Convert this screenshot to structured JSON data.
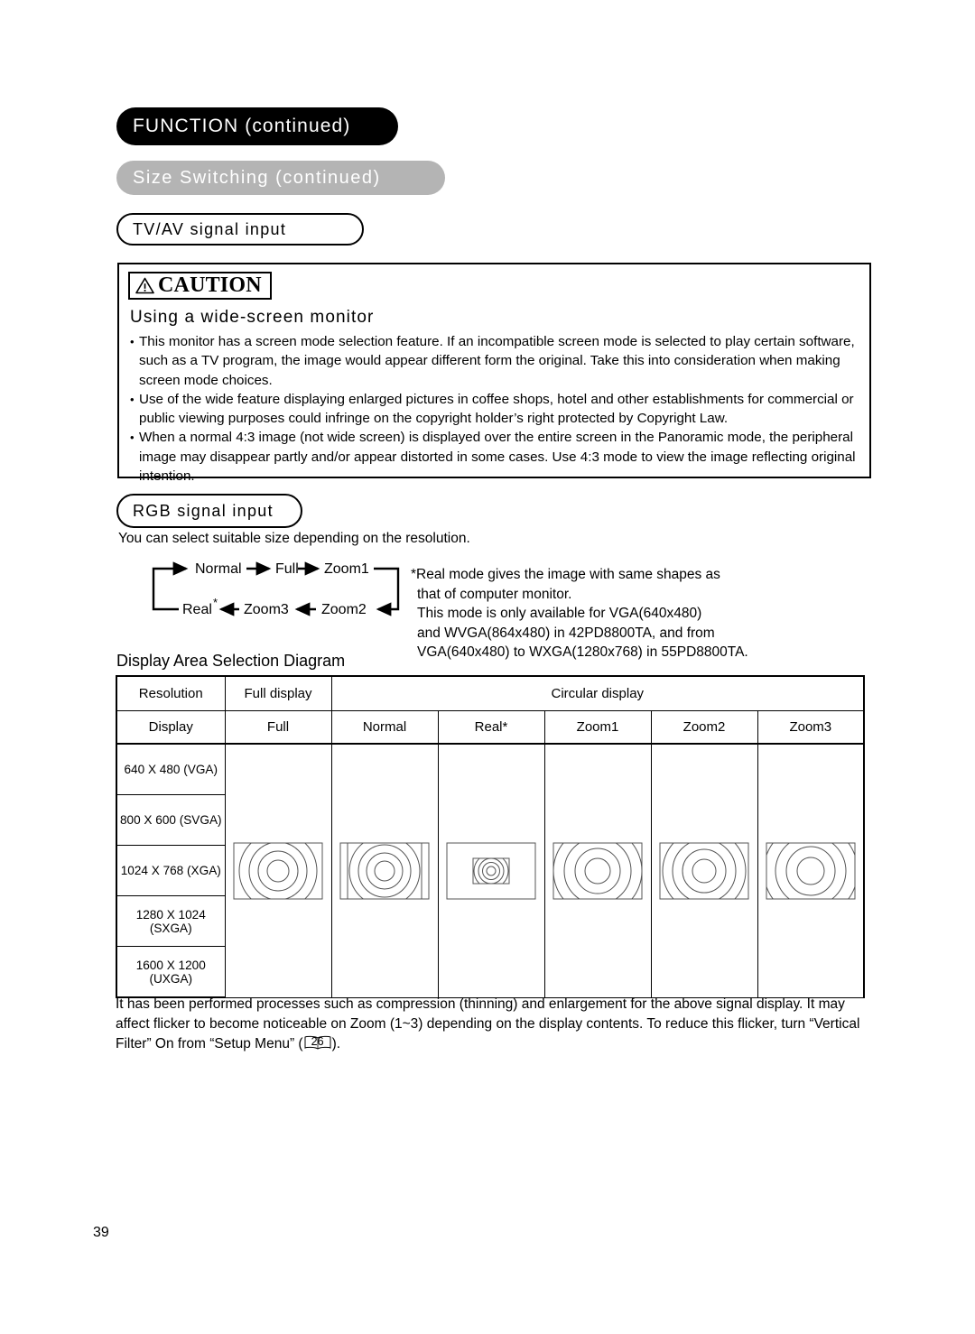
{
  "header": {
    "chapter": "FUNCTION (continued)",
    "section": "Size Switching (continued)",
    "subsection_tvav": "TV/AV signal input",
    "subsection_rgb": "RGB signal input"
  },
  "caution": {
    "badge_label": "CAUTION",
    "badge_icon": "warning-triangle-icon",
    "subtitle": "Using a wide-screen monitor",
    "bullets": [
      "This monitor has a screen mode selection feature. If an incompatible screen mode is selected to play certain software, such as a TV program, the image would appear different form the original. Take this into consideration when making screen mode choices.",
      "Use of the wide feature displaying enlarged pictures in coffee shops, hotel and other establishments for commercial or public viewing purposes could infringe on the copyright holder’s right protected by Copyright Law.",
      "When a normal 4:3 image (not wide screen) is displayed over the entire screen in the Panoramic mode, the peripheral image may disappear partly and/or appear distorted in some cases. Use 4:3 mode to view the image reflecting original intention."
    ]
  },
  "rgb": {
    "lead": "You can select suitable size depending on the resolution.",
    "cycle": {
      "top_row": [
        "Normal",
        "Full",
        "Zoom1"
      ],
      "bottom_row": [
        "Real*",
        "Zoom3",
        "Zoom2"
      ],
      "labels": {
        "normal": "Normal",
        "full": "Full",
        "zoom1": "Zoom1",
        "zoom2": "Zoom2",
        "zoom3": "Zoom3",
        "real": "Real",
        "real_star": "*"
      }
    },
    "note_lines": [
      "*Real mode gives the image with same shapes as",
      "that of computer monitor.",
      "This mode is only available for VGA(640x480)",
      "and WVGA(864x480) in 42PD8800TA, and from",
      "VGA(640x480) to WXGA(1280x768) in 55PD8800TA."
    ]
  },
  "table": {
    "title": "Display Area Selection Diagram",
    "group_headers": {
      "resolution": "Resolution",
      "full_display": "Full display",
      "circular_display": "Circular display"
    },
    "column_headers": [
      "Display",
      "Full",
      "Normal",
      "Real*",
      "Zoom1",
      "Zoom2",
      "Zoom3"
    ],
    "resolutions": [
      "640 X 480 (VGA)",
      "800 X 600 (SVGA)",
      "1024 X 768 (XGA)",
      "1280 X 1024 (SXGA)",
      "1600 X 1200 (UXGA)"
    ],
    "diagram_names": [
      "full-diagram",
      "normal-diagram",
      "real-diagram",
      "zoom1-diagram",
      "zoom2-diagram",
      "zoom3-diagram"
    ]
  },
  "footer": {
    "paragraph_part1": "It has been performed processes such as compression (thinning) and enlargement for the above signal display. It may affect flicker to become noticeable on Zoom (1~3) depending on the display contents. To reduce this flicker, turn “Vertical Filter” On from “Setup Menu” (",
    "page_ref": "26",
    "paragraph_part2": ").",
    "page_number": "39"
  },
  "colors": {
    "chapter_bg": "#000000",
    "chapter_fg": "#ffffff",
    "section_bg": "#b4b4b4",
    "section_fg": "#ffffff",
    "text": "#000000",
    "page_bg": "#ffffff"
  }
}
